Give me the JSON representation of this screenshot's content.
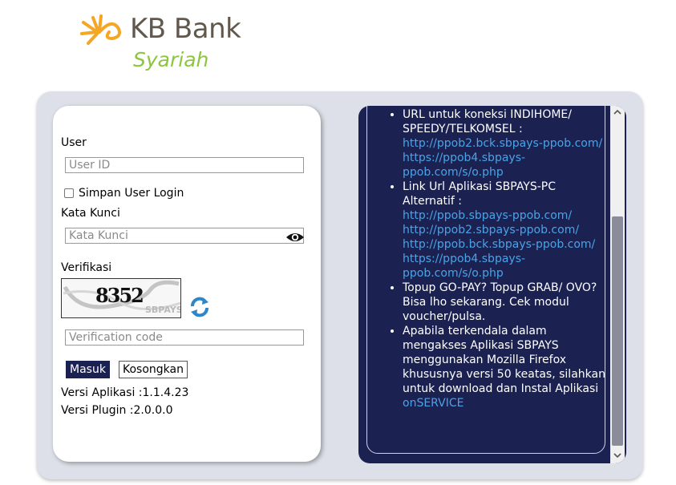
{
  "logo": {
    "name": "KB Bank",
    "subname": "Syariah"
  },
  "login": {
    "user_label": "User",
    "user_placeholder": "User ID",
    "remember_label": "Simpan User Login",
    "password_label": "Kata Kunci",
    "password_placeholder": "Kata Kunci",
    "verify_label": "Verifikasi",
    "captcha_code": "8352",
    "captcha_brand": "SBPAYS",
    "verify_placeholder": "Verification code",
    "submit_label": "Masuk",
    "clear_label": "Kosongkan",
    "app_version": "Versi Aplikasi :1.1.4.23",
    "plugin_version": "Versi Plugin :2.0.0.0"
  },
  "info": {
    "item1_text": "URL untuk koneksi INDIHOME/ SPEEDY/TELKOMSEL :",
    "item1_links": [
      "http://ppob2.bck.sbpays-ppob.com/",
      "https://ppob4.sbpays-ppob.com/s/o.php"
    ],
    "item2_text": "Link Url Aplikasi SBPAYS-PC Alternatif :",
    "item2_links": [
      "http://ppob.sbpays-ppob.com/",
      "http://ppob2.sbpays-ppob.com/",
      "http://ppob.bck.sbpays-ppob.com/",
      "https://ppob4.sbpays-ppob.com/s/o.php"
    ],
    "item3_text": "Topup GO-PAY? Topup GRAB/ OVO? Bisa lho sekarang. Cek modul voucher/pulsa.",
    "item4_text": "Apabila terkendala dalam mengakses Aplikasi SBPAYS menggunakan Mozilla Firefox khususnya versi 50 keatas, silahkan untuk download dan Instal Aplikasi",
    "item4_link": "onSERVICE"
  },
  "colors": {
    "navy": "#1b2150",
    "link": "#4aa3e8",
    "green": "#8cc63f",
    "orange": "#f5a623"
  }
}
